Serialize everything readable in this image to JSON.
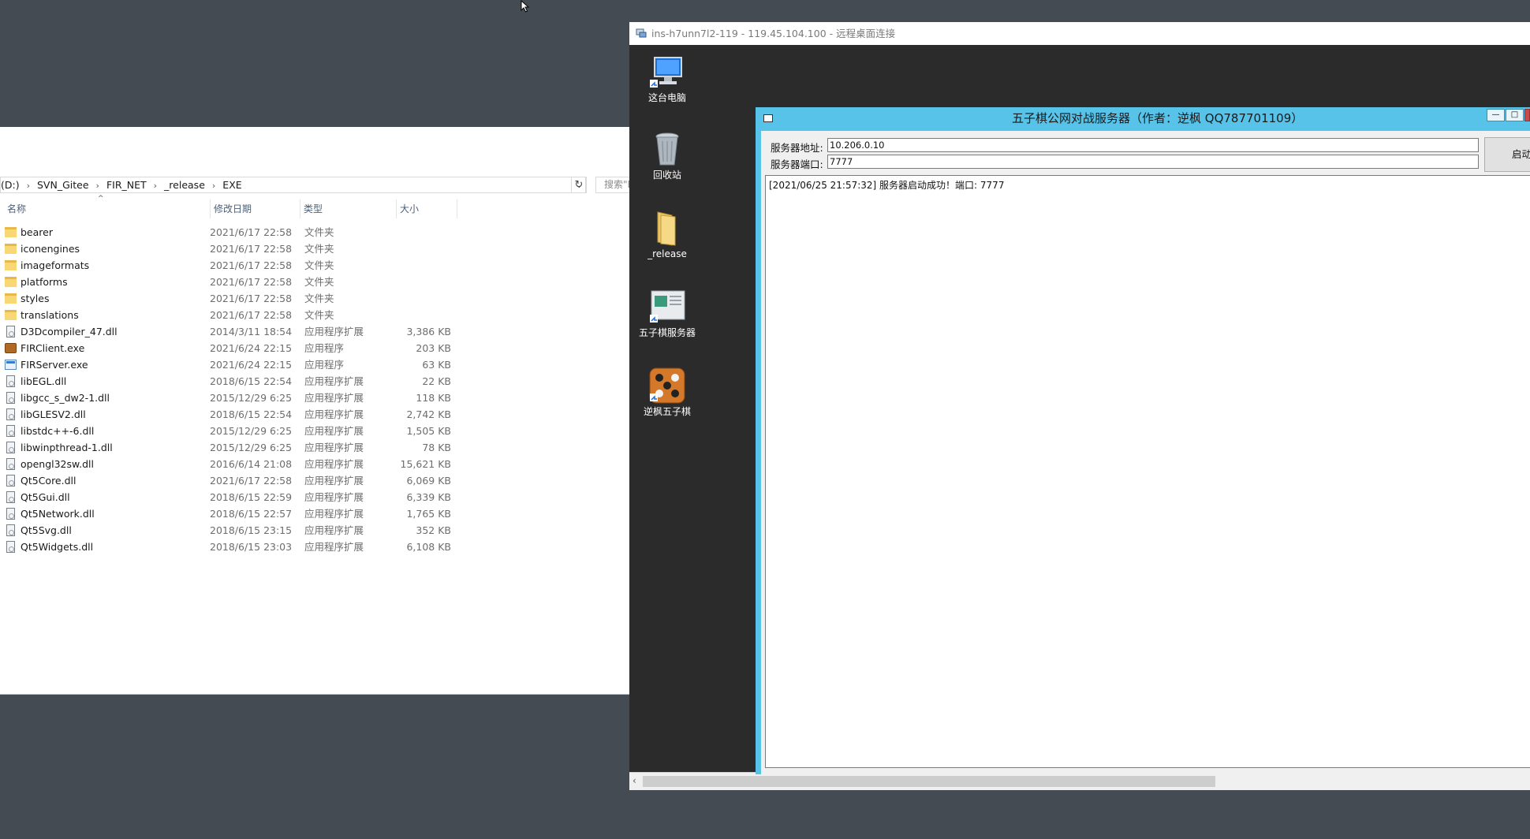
{
  "explorer": {
    "address": {
      "crumbs": [
        "(D:)",
        "SVN_Gitee",
        "FIR_NET",
        "_release",
        "EXE"
      ],
      "search_placeholder": "搜索\"E"
    },
    "columns": {
      "name": "名称",
      "date": "修改日期",
      "type": "类型",
      "size": "大小"
    },
    "files": [
      {
        "name": "bearer",
        "date": "2021/6/17 22:58",
        "type": "文件夹",
        "size": "",
        "icon": "folder"
      },
      {
        "name": "iconengines",
        "date": "2021/6/17 22:58",
        "type": "文件夹",
        "size": "",
        "icon": "folder"
      },
      {
        "name": "imageformats",
        "date": "2021/6/17 22:58",
        "type": "文件夹",
        "size": "",
        "icon": "folder"
      },
      {
        "name": "platforms",
        "date": "2021/6/17 22:58",
        "type": "文件夹",
        "size": "",
        "icon": "folder"
      },
      {
        "name": "styles",
        "date": "2021/6/17 22:58",
        "type": "文件夹",
        "size": "",
        "icon": "folder"
      },
      {
        "name": "translations",
        "date": "2021/6/17 22:58",
        "type": "文件夹",
        "size": "",
        "icon": "folder"
      },
      {
        "name": "D3Dcompiler_47.dll",
        "date": "2014/3/11 18:54",
        "type": "应用程序扩展",
        "size": "3,386 KB",
        "icon": "dll"
      },
      {
        "name": "FIRClient.exe",
        "date": "2021/6/24 22:15",
        "type": "应用程序",
        "size": "203 KB",
        "icon": "exe1"
      },
      {
        "name": "FIRServer.exe",
        "date": "2021/6/24 22:15",
        "type": "应用程序",
        "size": "63 KB",
        "icon": "exe2"
      },
      {
        "name": "libEGL.dll",
        "date": "2018/6/15 22:54",
        "type": "应用程序扩展",
        "size": "22 KB",
        "icon": "dll"
      },
      {
        "name": "libgcc_s_dw2-1.dll",
        "date": "2015/12/29 6:25",
        "type": "应用程序扩展",
        "size": "118 KB",
        "icon": "dll"
      },
      {
        "name": "libGLESV2.dll",
        "date": "2018/6/15 22:54",
        "type": "应用程序扩展",
        "size": "2,742 KB",
        "icon": "dll"
      },
      {
        "name": "libstdc++-6.dll",
        "date": "2015/12/29 6:25",
        "type": "应用程序扩展",
        "size": "1,505 KB",
        "icon": "dll"
      },
      {
        "name": "libwinpthread-1.dll",
        "date": "2015/12/29 6:25",
        "type": "应用程序扩展",
        "size": "78 KB",
        "icon": "dll"
      },
      {
        "name": "opengl32sw.dll",
        "date": "2016/6/14 21:08",
        "type": "应用程序扩展",
        "size": "15,621 KB",
        "icon": "dll"
      },
      {
        "name": "Qt5Core.dll",
        "date": "2021/6/17 22:58",
        "type": "应用程序扩展",
        "size": "6,069 KB",
        "icon": "dll"
      },
      {
        "name": "Qt5Gui.dll",
        "date": "2018/6/15 22:59",
        "type": "应用程序扩展",
        "size": "6,339 KB",
        "icon": "dll"
      },
      {
        "name": "Qt5Network.dll",
        "date": "2018/6/15 22:57",
        "type": "应用程序扩展",
        "size": "1,765 KB",
        "icon": "dll"
      },
      {
        "name": "Qt5Svg.dll",
        "date": "2018/6/15 23:15",
        "type": "应用程序扩展",
        "size": "352 KB",
        "icon": "dll"
      },
      {
        "name": "Qt5Widgets.dll",
        "date": "2018/6/15 23:03",
        "type": "应用程序扩展",
        "size": "6,108 KB",
        "icon": "dll"
      }
    ]
  },
  "rdp": {
    "title": "ins-h7unn7l2-119 - 119.45.104.100 - 远程桌面连接",
    "desktop_icons": [
      {
        "label": "这台电脑",
        "icon": "computer-icon"
      },
      {
        "label": "回收站",
        "icon": "recycle-bin-icon"
      },
      {
        "label": "_release",
        "icon": "folder-icon"
      },
      {
        "label": "五子棋服务器",
        "icon": "server-app-icon"
      },
      {
        "label": "逆枫五子棋",
        "icon": "gomoku-icon"
      }
    ]
  },
  "app": {
    "title": "五子棋公网对战服务器（作者：逆枫 QQ787701109）",
    "address_label": "服务器地址:",
    "address_value": "10.206.0.10",
    "port_label": "服务器端口:",
    "port_value": "7777",
    "start_label": "启动",
    "log": "[2021/06/25 21:57:32] 服务器启动成功！端口: 7777"
  },
  "colors": {
    "desktop_bg": "#454b52",
    "rdp_bg": "#2b2b2b",
    "app_accent": "#57c3e8"
  }
}
